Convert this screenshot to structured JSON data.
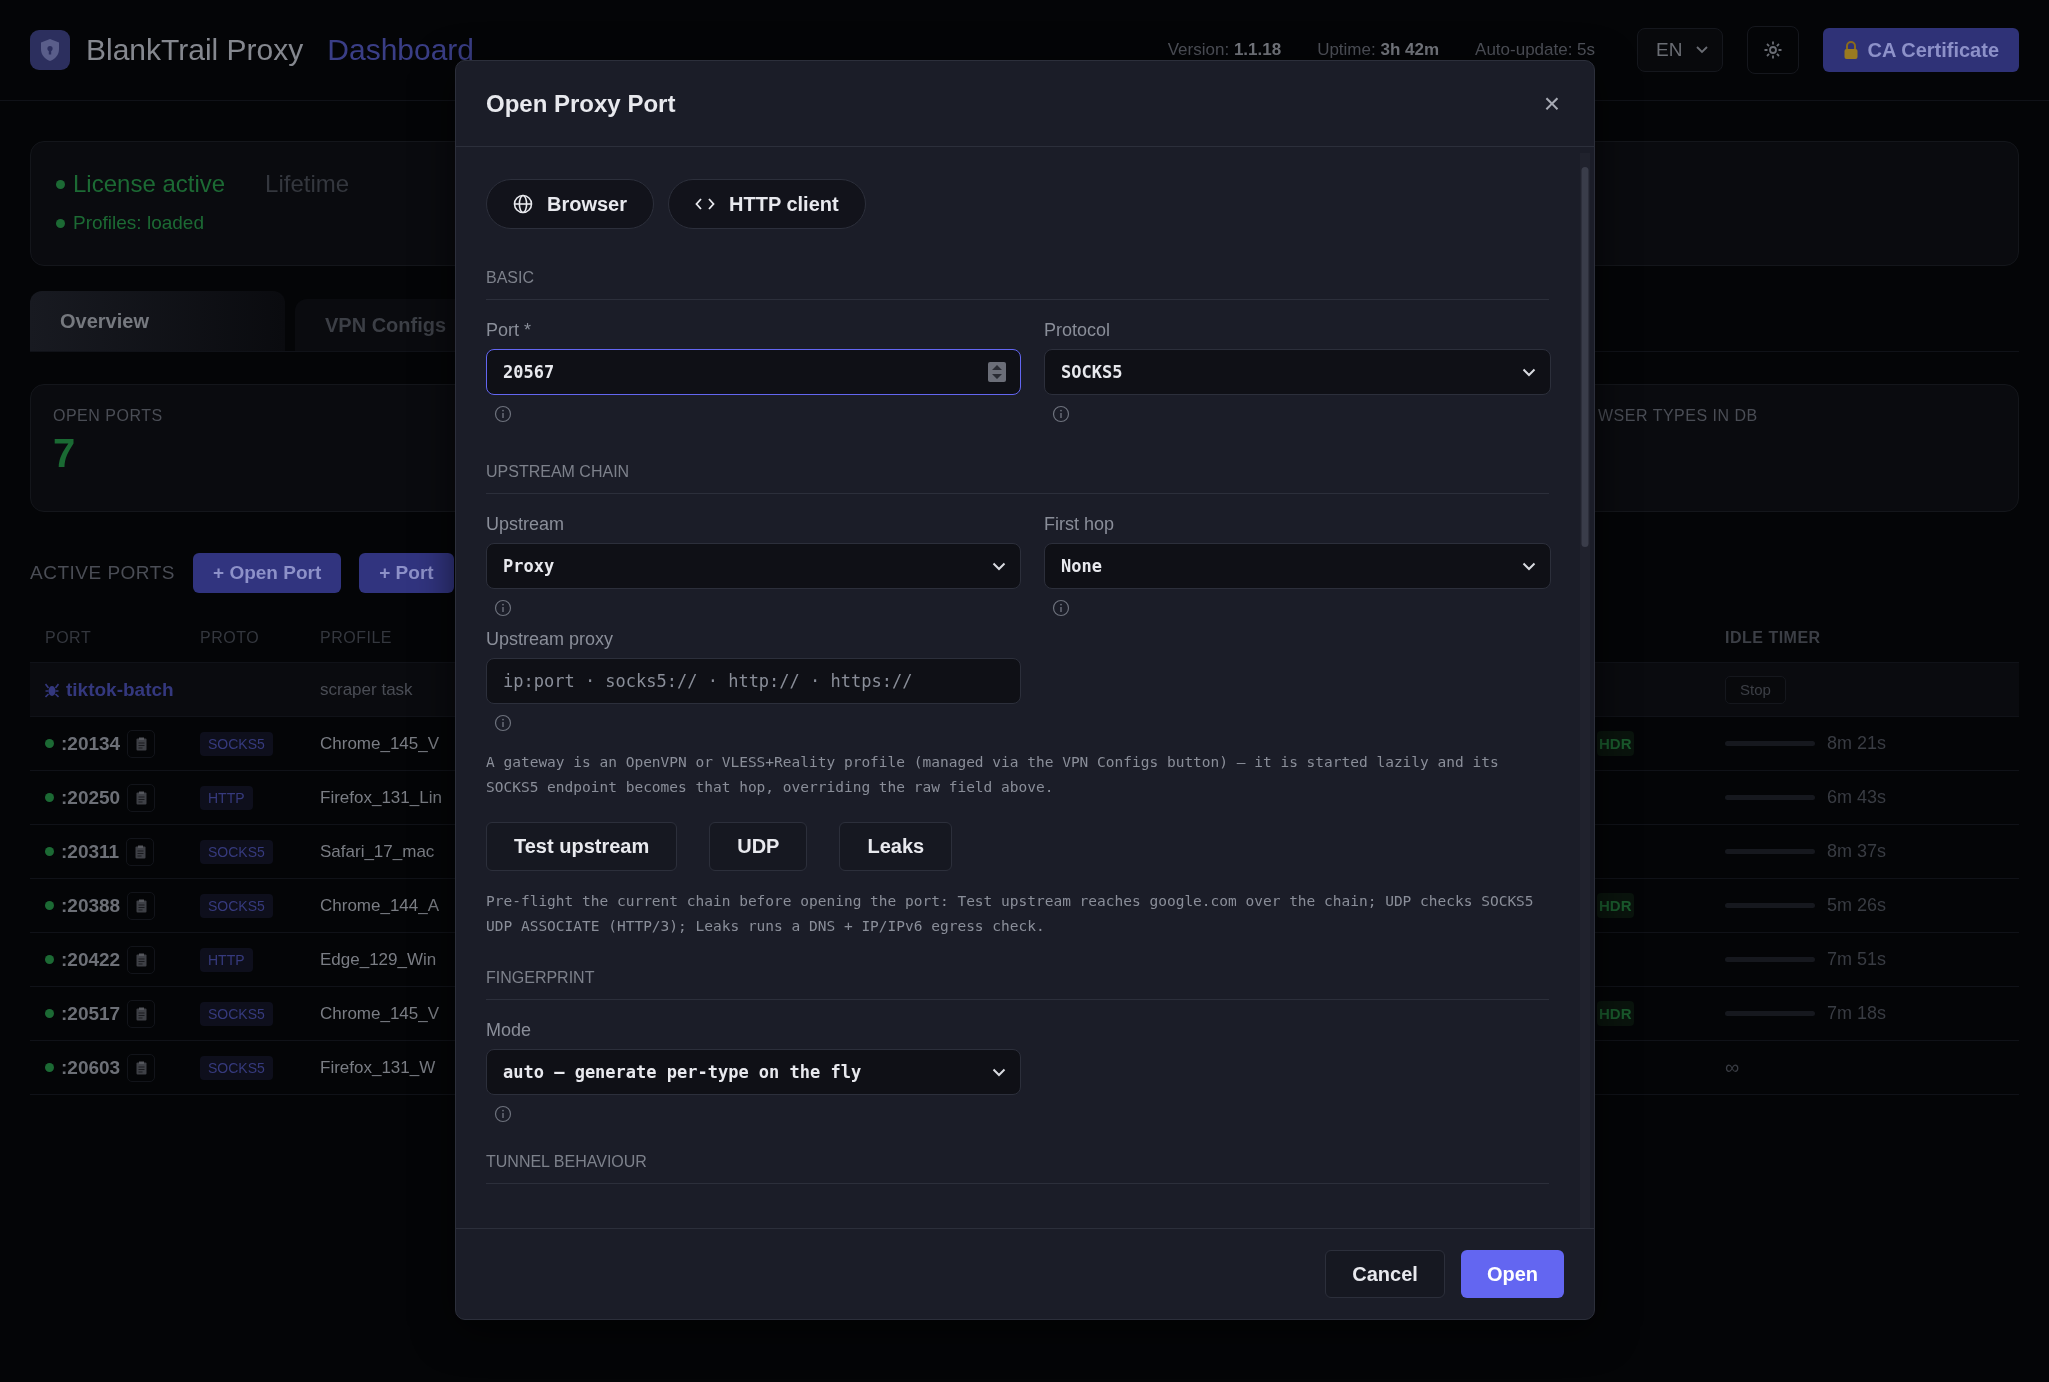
{
  "header": {
    "app_name": "BlankTrail Proxy",
    "section": "Dashboard",
    "version_label": "Version:",
    "version": "1.1.18",
    "uptime_label": "Uptime:",
    "uptime": "3h 42m",
    "auto_update": "Auto-update: 5s",
    "language": "EN",
    "ca_button": "CA Certificate"
  },
  "license": {
    "status": "License active",
    "plan": "Lifetime",
    "profiles": "Profiles: loaded"
  },
  "tabs": [
    {
      "label": "Overview",
      "selected": true
    },
    {
      "label": "VPN Configs",
      "selected": false
    }
  ],
  "stats": [
    {
      "label": "OPEN PORTS",
      "value": "7"
    },
    {
      "label": "WSER TYPES IN DB"
    }
  ],
  "active_ports": {
    "title": "ACTIVE PORTS",
    "buttons": [
      "+ Open Port",
      "+ Port"
    ]
  },
  "table": {
    "columns": [
      "PORT",
      "PROTO",
      "PROFILE"
    ],
    "right_columns": [
      "IDLE TIMER"
    ],
    "group": {
      "name": "tiktok-batch",
      "task": "scraper task",
      "action": "Stop"
    },
    "rows": [
      {
        "port": ":20134",
        "proto": "SOCKS5",
        "profile": "Chrome_145_V",
        "badge": "HDR",
        "timer": "8m 21s"
      },
      {
        "port": ":20250",
        "proto": "HTTP",
        "profile": "Firefox_131_Lin",
        "timer": "6m 43s"
      },
      {
        "port": ":20311",
        "proto": "SOCKS5",
        "profile": "Safari_17_mac",
        "timer": "8m 37s"
      },
      {
        "port": ":20388",
        "proto": "SOCKS5",
        "profile": "Chrome_144_A",
        "badge": "HDR",
        "timer": "5m 26s"
      },
      {
        "port": ":20422",
        "proto": "HTTP",
        "profile": "Edge_129_Win",
        "timer": "7m 51s"
      },
      {
        "port": ":20517",
        "proto": "SOCKS5",
        "profile": "Chrome_145_V",
        "badge": "HDR",
        "timer": "7m 18s"
      },
      {
        "port": ":20603",
        "proto": "SOCKS5",
        "profile": "Firefox_131_W",
        "timer": "∞",
        "kind": "unlimited"
      }
    ]
  },
  "modal": {
    "title": "Open Proxy Port",
    "close": "×",
    "modes": [
      {
        "label": "Browser"
      },
      {
        "label": "HTTP client"
      }
    ],
    "basic": {
      "title": "BASIC",
      "port": {
        "label": "Port *",
        "value": "20567"
      },
      "protocol": {
        "label": "Protocol",
        "value": "SOCKS5"
      }
    },
    "upstream": {
      "title": "UPSTREAM CHAIN",
      "upstream": {
        "label": "Upstream",
        "value": "Proxy"
      },
      "first_hop": {
        "label": "First hop",
        "value": "None"
      },
      "proxy": {
        "label": "Upstream proxy",
        "placeholder": "ip:port · socks5:// · http:// · https://"
      },
      "note": "A gateway is an OpenVPN or VLESS+Reality profile (managed via the VPN Configs button) — it is started lazily and its SOCKS5 endpoint becomes that hop, overriding the raw field above.",
      "buttons": [
        "Test upstream",
        "UDP",
        "Leaks"
      ],
      "preflight": "Pre-flight the current chain before opening the port: Test upstream reaches google.com over the chain; UDP checks SOCKS5 UDP ASSOCIATE (HTTP/3); Leaks runs a DNS + IP/IPv6 egress check."
    },
    "fingerprint": {
      "title": "FINGERPRINT",
      "mode": {
        "label": "Mode",
        "value": "auto — generate per-type on the fly"
      }
    },
    "tunnel": {
      "title": "TUNNEL BEHAVIOUR"
    },
    "footer": {
      "cancel": "Cancel",
      "open": "Open"
    }
  }
}
